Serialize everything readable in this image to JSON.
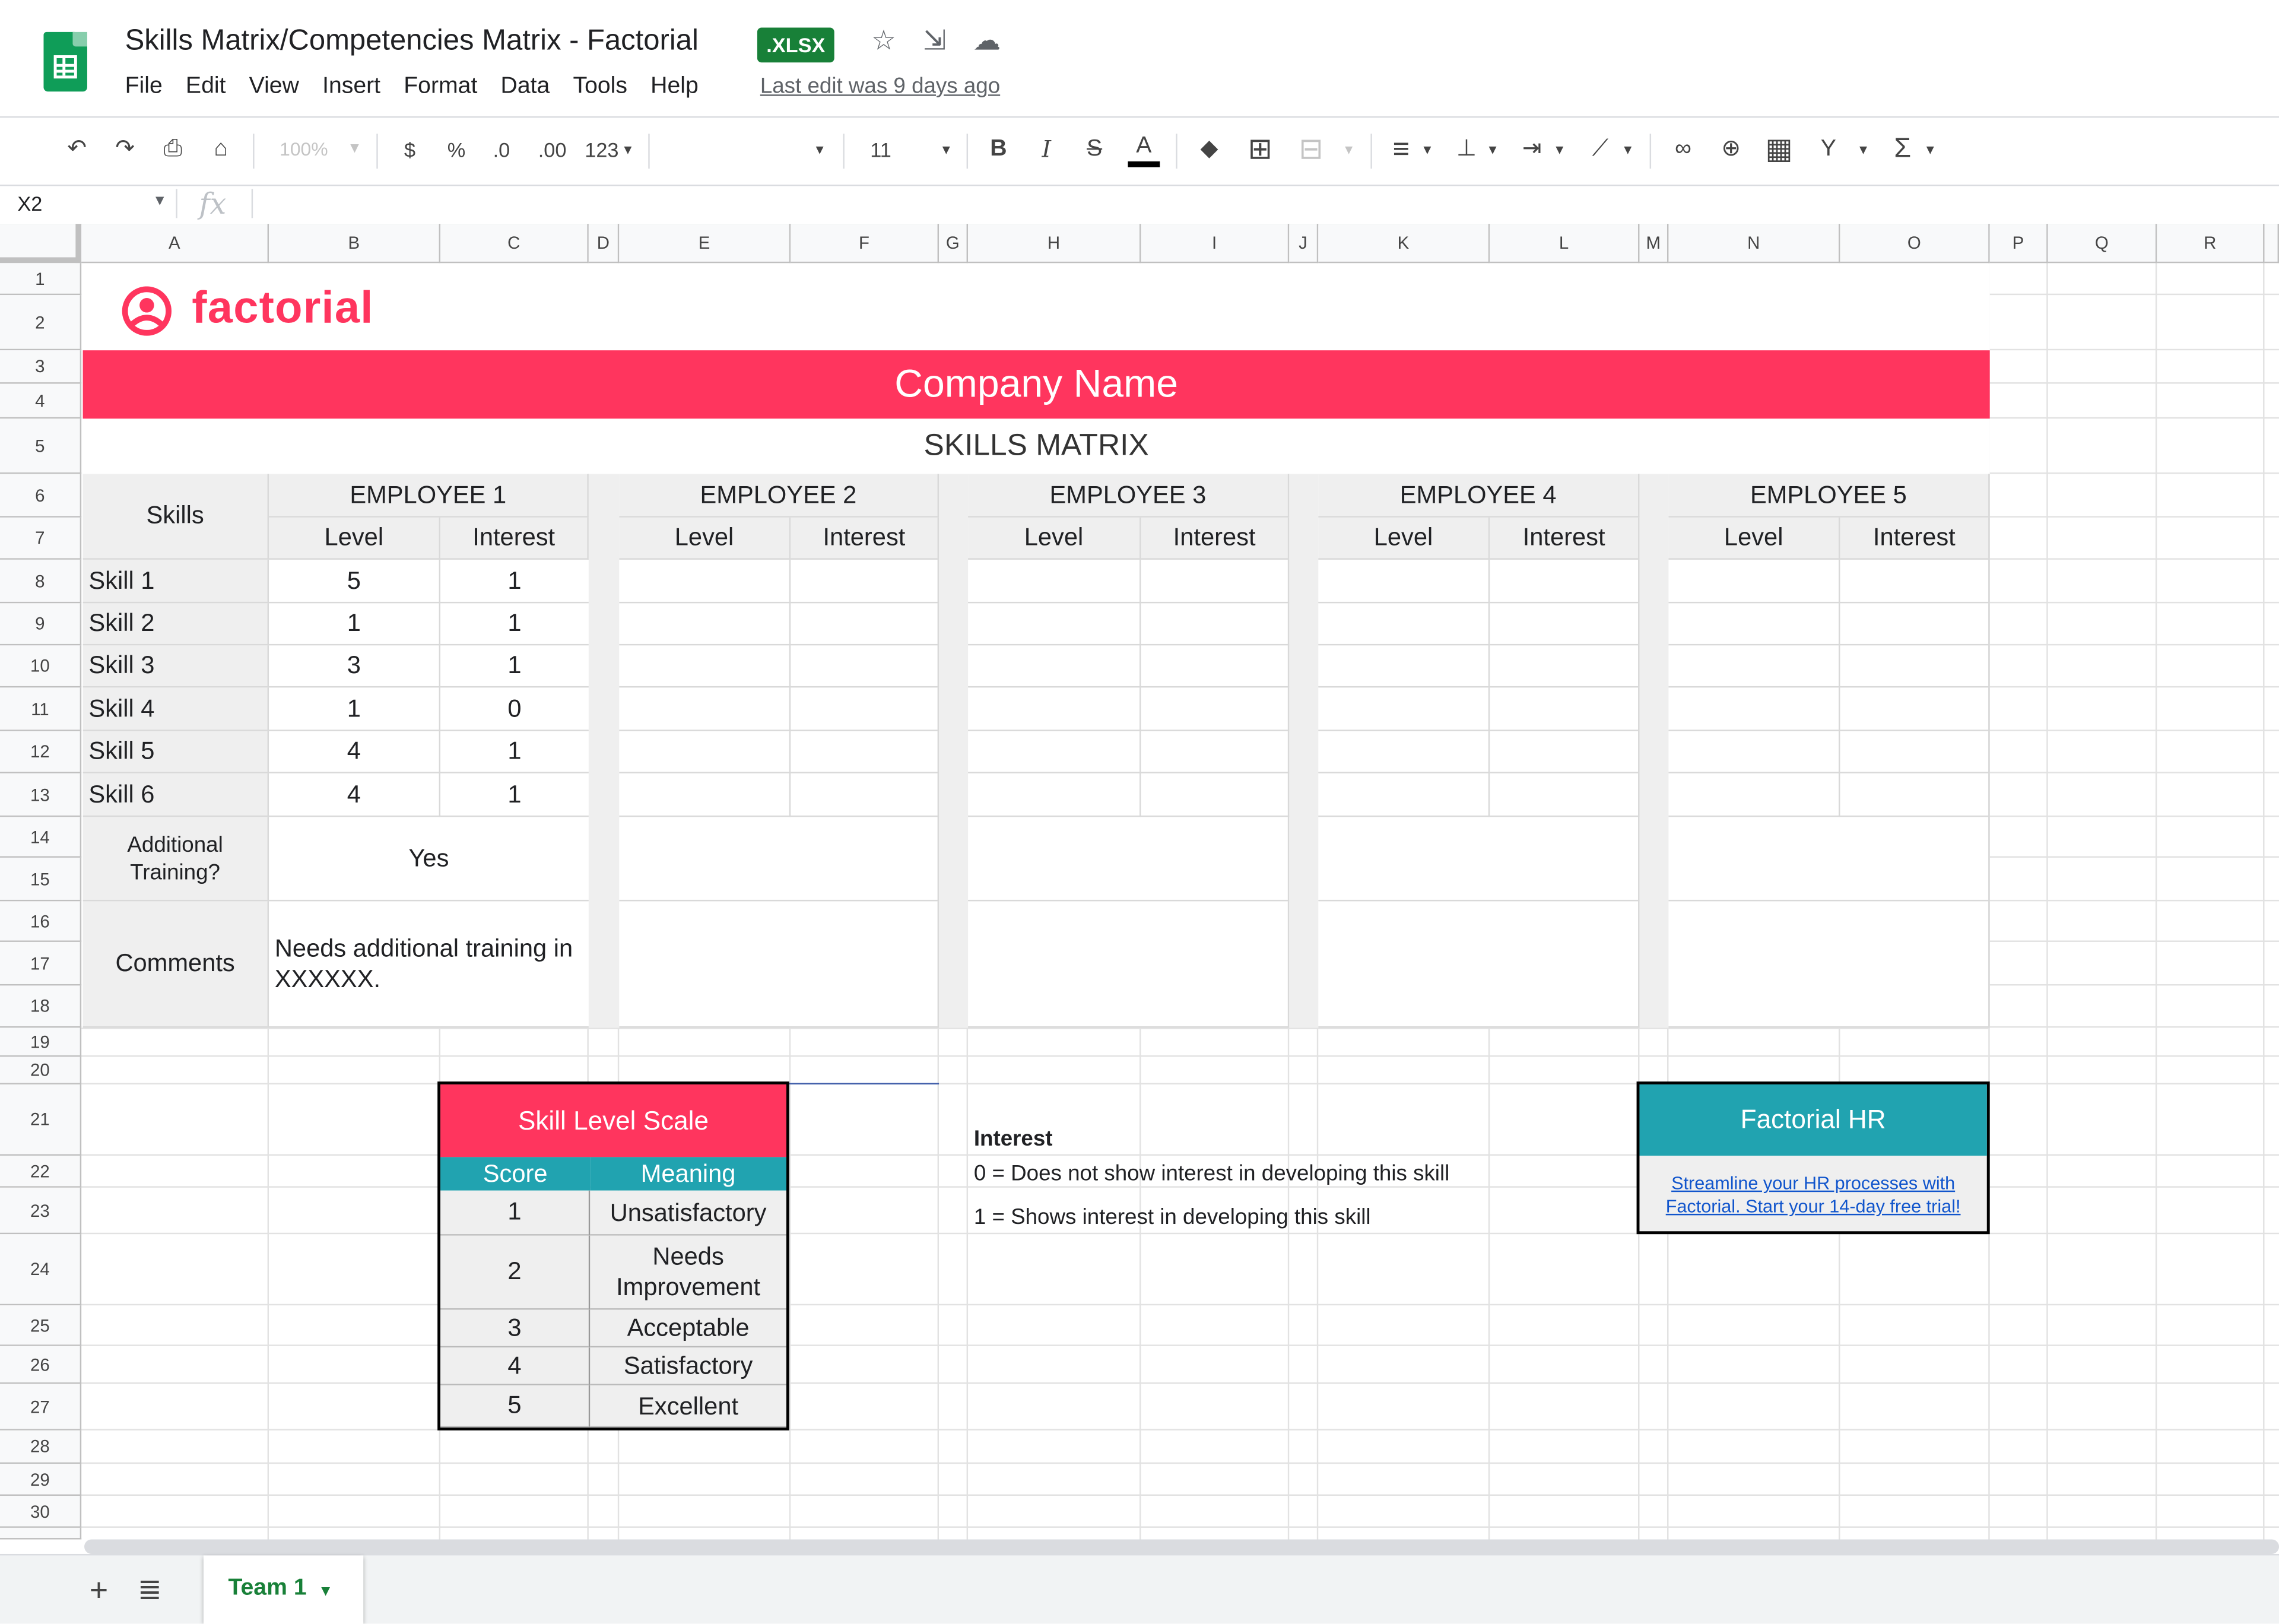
{
  "header": {
    "title": "Skills Matrix/Competencies Matrix - Factorial",
    "badge": ".XLSX",
    "star_icon": "☆",
    "move_icon": "⇲",
    "cloud_icon": "☁",
    "last_edit": "Last edit was 9 days ago",
    "menu": [
      "File",
      "Edit",
      "View",
      "Insert",
      "Format",
      "Data",
      "Tools",
      "Help"
    ]
  },
  "toolbar": {
    "undo": "↶",
    "redo": "↷",
    "print": "⎙",
    "paint": "⌂",
    "zoom": "100%",
    "currency": "$",
    "percent": "%",
    "dec_less": ".0",
    "dec_more": ".00",
    "more_formats": "123",
    "font_size": "11",
    "bold": "B",
    "italic": "I",
    "strike": "S",
    "text_color": "A",
    "fill": "◆",
    "borders": "⊞",
    "merge": "⊟",
    "halign": "≡",
    "valign": "⊥",
    "wrap": "⇥",
    "rotate": "⟋",
    "link": "∞",
    "comment": "⊕",
    "chart": "▦",
    "filter": "Y",
    "functions": "Σ"
  },
  "formula_bar": {
    "namebox": "X2",
    "fx": "fx"
  },
  "columns": [
    "A",
    "B",
    "C",
    "D",
    "E",
    "F",
    "G",
    "H",
    "I",
    "J",
    "K",
    "L",
    "M",
    "N",
    "O",
    "P",
    "Q",
    "R"
  ],
  "rows": [
    "1",
    "2",
    "3",
    "4",
    "5",
    "6",
    "7",
    "8",
    "9",
    "10",
    "11",
    "12",
    "13",
    "14",
    "15",
    "16",
    "17",
    "18",
    "19",
    "20",
    "21",
    "22",
    "23",
    "24",
    "25",
    "26",
    "27",
    "28",
    "29",
    "30"
  ],
  "sheet": {
    "logo_text": "factorial",
    "company": "Company Name",
    "matrix_title": "SKILLS MATRIX",
    "skills_header": "Skills",
    "level_label": "Level",
    "interest_label": "Interest",
    "employees": [
      "EMPLOYEE 1",
      "EMPLOYEE 2",
      "EMPLOYEE 3",
      "EMPLOYEE 4",
      "EMPLOYEE 5"
    ],
    "skills": [
      {
        "name": "Skill 1",
        "level": "5",
        "interest": "1"
      },
      {
        "name": "Skill 2",
        "level": "1",
        "interest": "1"
      },
      {
        "name": "Skill 3",
        "level": "3",
        "interest": "1"
      },
      {
        "name": "Skill 4",
        "level": "1",
        "interest": "0"
      },
      {
        "name": "Skill 5",
        "level": "4",
        "interest": "1"
      },
      {
        "name": "Skill 6",
        "level": "4",
        "interest": "1"
      }
    ],
    "training_label": "Additional Training?",
    "training_value": "Yes",
    "comments_label": "Comments",
    "comments_value": "Needs additional training in XXXXXX."
  },
  "scale": {
    "title": "Skill Level Scale",
    "score_header": "Score",
    "meaning_header": "Meaning",
    "rows": [
      {
        "score": "1",
        "meaning": "Unsatisfactory"
      },
      {
        "score": "2",
        "meaning": "Needs Improvement"
      },
      {
        "score": "3",
        "meaning": "Acceptable"
      },
      {
        "score": "4",
        "meaning": "Satisfactory"
      },
      {
        "score": "5",
        "meaning": "Excellent"
      }
    ]
  },
  "interest_legend": {
    "title": "Interest",
    "line0": "0 = Does not show interest in developing this skill",
    "line1": "1 = Shows interest in developing this skill"
  },
  "promo": {
    "title": "Factorial HR",
    "link": "Streamline your HR processes with Factorial. Start your 14-day free trial!"
  },
  "bottom": {
    "add_sheet": "+",
    "all_sheets": "≣",
    "tab": "Team 1",
    "tab_arrow": "▾"
  },
  "colors": {
    "brand": "#ff355e",
    "teal": "#21a3b0",
    "badge": "#188038",
    "sheets_green": "#0f9d58"
  }
}
